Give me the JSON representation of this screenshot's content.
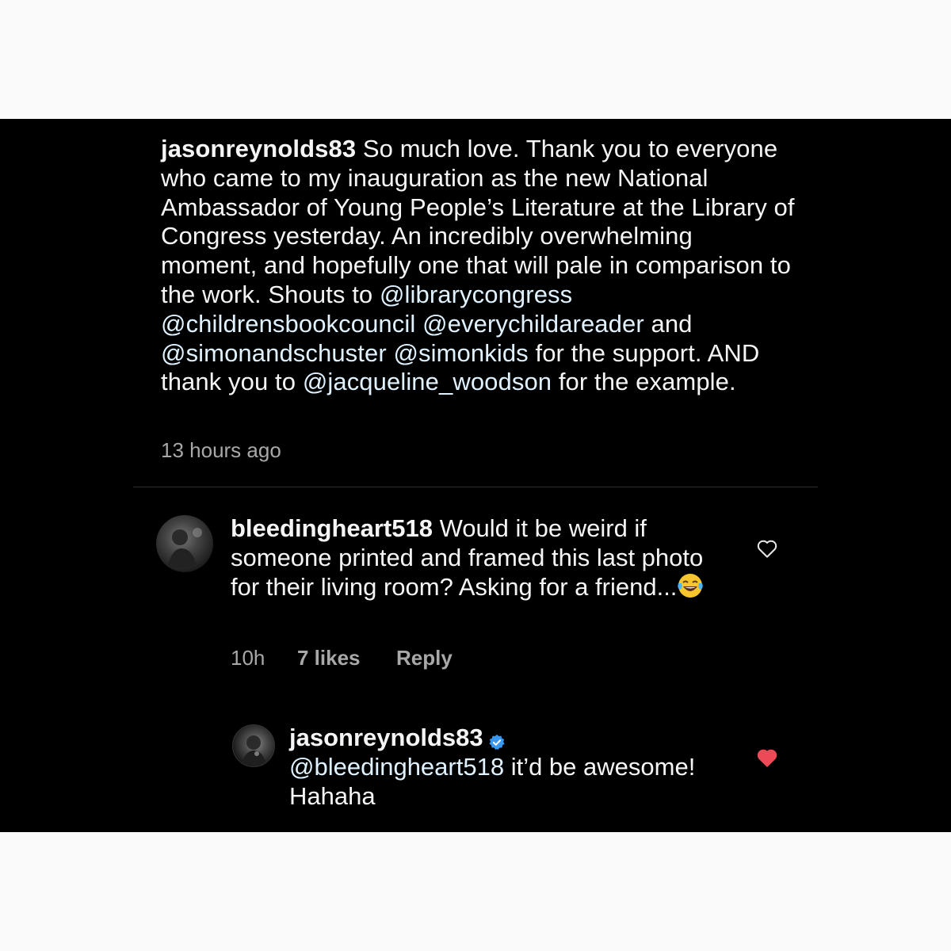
{
  "post": {
    "username": "jasonreynolds83",
    "caption_parts": [
      " So much love. Thank you to everyone who came to my inauguration as the new National Ambassador of Young People’s Literature at the Library of Congress yesterday. An incredibly overwhelming moment, and hopefully one that will pale in comparison to the work. Shouts to ",
      "@librarycongress",
      " ",
      "@childrensbookcouncil",
      " ",
      "@everychildareader",
      " and ",
      "@simonandschuster",
      " ",
      "@simonkids",
      " for the support. AND thank you to ",
      "@jacqueline_woodson",
      " for the example."
    ],
    "timestamp": "13 hours ago"
  },
  "comment": {
    "username": "bleedingheart518",
    "text": " Would it be weird if someone printed and framed this last photo for their living room? Asking for a friend...",
    "emoji": "face-with-tears-of-joy",
    "time": "10h",
    "likes": "7 likes",
    "reply_label": "Reply",
    "like_state": "not-liked",
    "avatar_icon": "user-avatar"
  },
  "reply": {
    "username": "jasonreynolds83",
    "verified": true,
    "mention": "@bleedingheart518",
    "text": " it’d be awesome! Hahaha",
    "like_state": "liked",
    "avatar_icon": "user-avatar"
  },
  "colors": {
    "background": "#000000",
    "text": "#f5f5f5",
    "secondary": "#a8a8a8",
    "heart_liked": "#ed4956",
    "verified": "#3897f0"
  }
}
